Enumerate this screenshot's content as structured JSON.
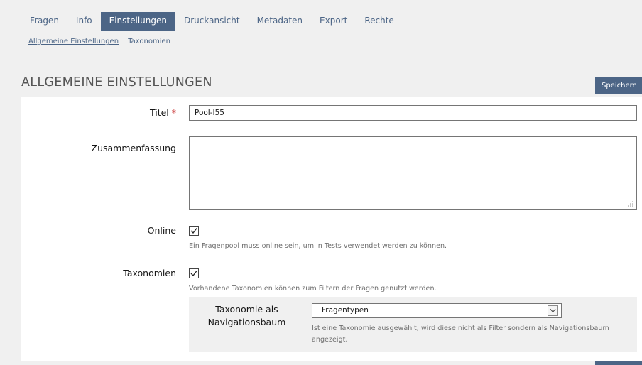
{
  "tabs": [
    {
      "label": "Fragen",
      "active": false
    },
    {
      "label": "Info",
      "active": false
    },
    {
      "label": "Einstellungen",
      "active": true
    },
    {
      "label": "Druckansicht",
      "active": false
    },
    {
      "label": "Metadaten",
      "active": false
    },
    {
      "label": "Export",
      "active": false
    },
    {
      "label": "Rechte",
      "active": false
    }
  ],
  "subtabs": [
    {
      "label": "Allgemeine Einstellungen",
      "active": true
    },
    {
      "label": "Taxonomien",
      "active": false
    }
  ],
  "section": {
    "title": "Allgemeine Einstellungen",
    "save_label": "Speichern"
  },
  "form": {
    "title_label": "Titel",
    "required_marker": "*",
    "title_value": "Pool-I55",
    "summary_label": "Zusammenfassung",
    "summary_value": "",
    "online_label": "Online",
    "online_checked": true,
    "online_info": "Ein Fragenpool muss online sein, um in Tests verwendet werden zu können.",
    "taxonomies_label": "Taxonomien",
    "taxonomies_checked": true,
    "taxonomies_info": "Vorhandene Taxonomien können zum Filtern der Fragen genutzt werden.",
    "navtree_label_line1": "Taxonomie als",
    "navtree_label_line2": "Navigationsbaum",
    "navtree_selected": "Fragentypen",
    "navtree_info": "Ist eine Taxonomie ausgewählt, wird diese nicht als Filter sondern als Navigationsbaum angezeigt."
  },
  "colors": {
    "accent": "#4c6586",
    "required": "#c72e2e",
    "info_text": "#6f6f6f",
    "page_background": "#f0f0f0"
  }
}
